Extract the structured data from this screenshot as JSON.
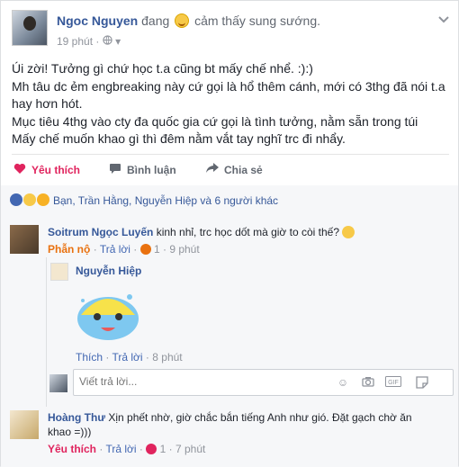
{
  "post": {
    "author": "Ngoc Nguyen",
    "feeling_prefix": "đang",
    "feeling_text": "cảm thấy sung sướng.",
    "time": "19 phút",
    "lines": [
      "Úi zời! Tưởng gì chứ học t.a cũng bt mấy chế nhể. :):)",
      "Mh tâu dc ẻm engbreaking này cứ gọi là hổ thêm cánh, mới có 3thg đã nói t.a",
      "hay hơn hót.",
      "Mục tiêu 4thg vào cty đa quốc gia cứ gọi là tình tưởng, nằm sẵn trong túi",
      "Mấy chế muốn khao gì thì đêm nằm vắt tay nghĩ trc đi nhẩy."
    ]
  },
  "actions": {
    "like": "Yêu thích",
    "comment": "Bình luận",
    "share": "Chia sẻ"
  },
  "reactions": {
    "summary": "Bạn, Trần Hằng, Nguyễn Hiệp và 6 người khác"
  },
  "comments": [
    {
      "name": "Soitrum Ngọc Luyến",
      "text": "kinh nhỉ, trc học dốt mà giờ to còi thế?",
      "reaction_label": "Phẫn nộ",
      "reply": "Trả lời",
      "count": "1",
      "time": "9 phút"
    },
    {
      "name": "Hoàng Thư",
      "text_line1": "Xịn phết nhờ, giờ chắc bắn tiếng Anh như gió. Đặt gạch chờ ăn",
      "text_line2": "khao =)))",
      "reaction_label": "Yêu thích",
      "reply": "Trả lời",
      "count": "1",
      "time": "7 phút"
    }
  ],
  "reply": {
    "name": "Nguyễn Hiệp",
    "like": "Thích",
    "reply": "Trả lời",
    "time": "8 phút"
  },
  "reply_input": {
    "placeholder": "Viết trả lời..."
  },
  "colors": {
    "link": "#365899",
    "love": "#e0245e",
    "angry": "#e9710f",
    "meta": "#90949c"
  }
}
